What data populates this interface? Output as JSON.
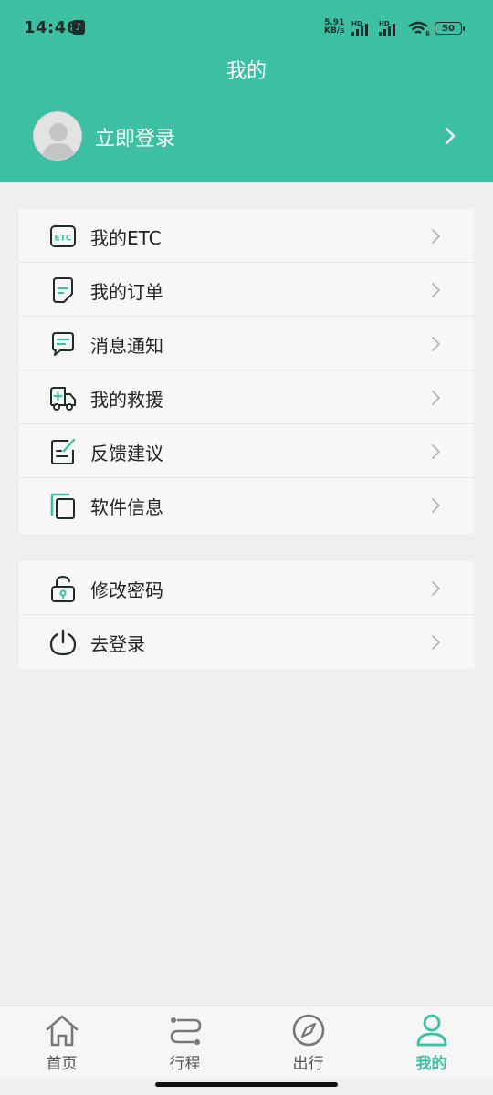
{
  "status_bar": {
    "time": "14:46",
    "net_speed_value": "5.91",
    "net_speed_unit": "KB/s",
    "hd1": "HD",
    "hd2": "HD",
    "wifi_sub": "6",
    "battery": "50"
  },
  "header": {
    "title": "我的",
    "login_label": "立即登录"
  },
  "menu_group_1": [
    {
      "label": "我的ETC",
      "icon": "etc-card-icon"
    },
    {
      "label": "我的订单",
      "icon": "order-document-icon"
    },
    {
      "label": "消息通知",
      "icon": "message-bubble-icon"
    },
    {
      "label": "我的救援",
      "icon": "rescue-vehicle-icon"
    },
    {
      "label": "反馈建议",
      "icon": "feedback-edit-icon"
    },
    {
      "label": "软件信息",
      "icon": "software-copy-icon"
    }
  ],
  "menu_group_2": [
    {
      "label": "修改密码",
      "icon": "unlock-icon"
    },
    {
      "label": "去登录",
      "icon": "power-icon"
    }
  ],
  "etc_icon_text": "ETC",
  "tabs": [
    {
      "label": "首页",
      "icon": "home-icon"
    },
    {
      "label": "行程",
      "icon": "route-icon"
    },
    {
      "label": "出行",
      "icon": "compass-icon"
    },
    {
      "label": "我的",
      "icon": "person-icon",
      "active": true
    }
  ],
  "colors": {
    "accent": "#3dbfa3",
    "background": "#efefef",
    "card": "#f7f7f7"
  }
}
